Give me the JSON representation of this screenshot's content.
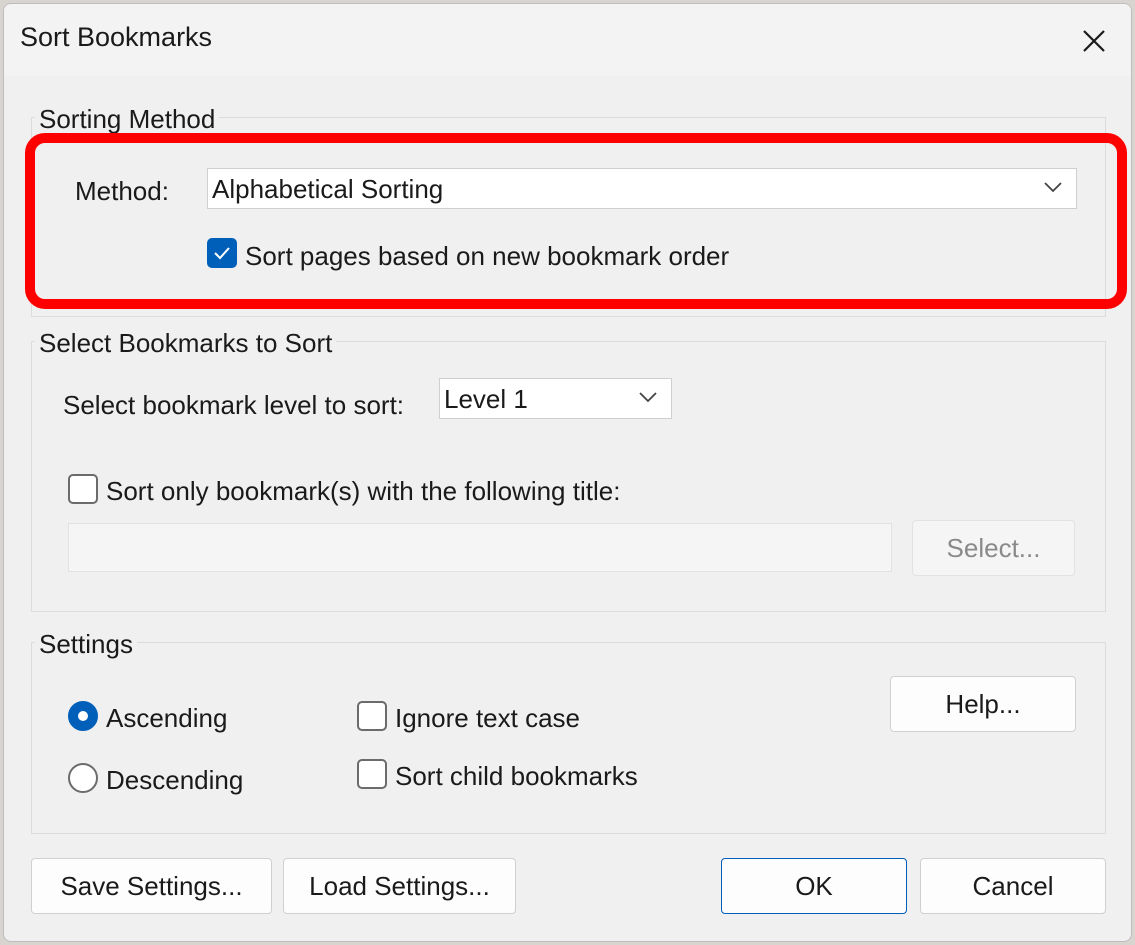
{
  "window": {
    "title": "Sort Bookmarks"
  },
  "sorting_method": {
    "group_label": "Sorting Method",
    "method_label": "Method:",
    "method_value": "Alphabetical Sorting",
    "sort_pages_label": "Sort pages based on new bookmark order",
    "sort_pages_checked": true
  },
  "select_bookmarks": {
    "group_label": "Select Bookmarks to Sort",
    "level_label": "Select bookmark level to sort:",
    "level_value": "Level 1",
    "title_only_label": "Sort only bookmark(s) with the following title:",
    "title_only_checked": false,
    "title_value": "",
    "select_button": "Select..."
  },
  "settings": {
    "group_label": "Settings",
    "ascending_label": "Ascending",
    "descending_label": "Descending",
    "order_selected": "Ascending",
    "ignore_case_label": "Ignore text case",
    "ignore_case_checked": false,
    "sort_child_label": "Sort child bookmarks",
    "sort_child_checked": false,
    "help_button": "Help..."
  },
  "footer": {
    "save_settings": "Save Settings...",
    "load_settings": "Load Settings...",
    "ok": "OK",
    "cancel": "Cancel"
  },
  "colors": {
    "accent": "#005fb8",
    "highlight": "#ff0000"
  }
}
